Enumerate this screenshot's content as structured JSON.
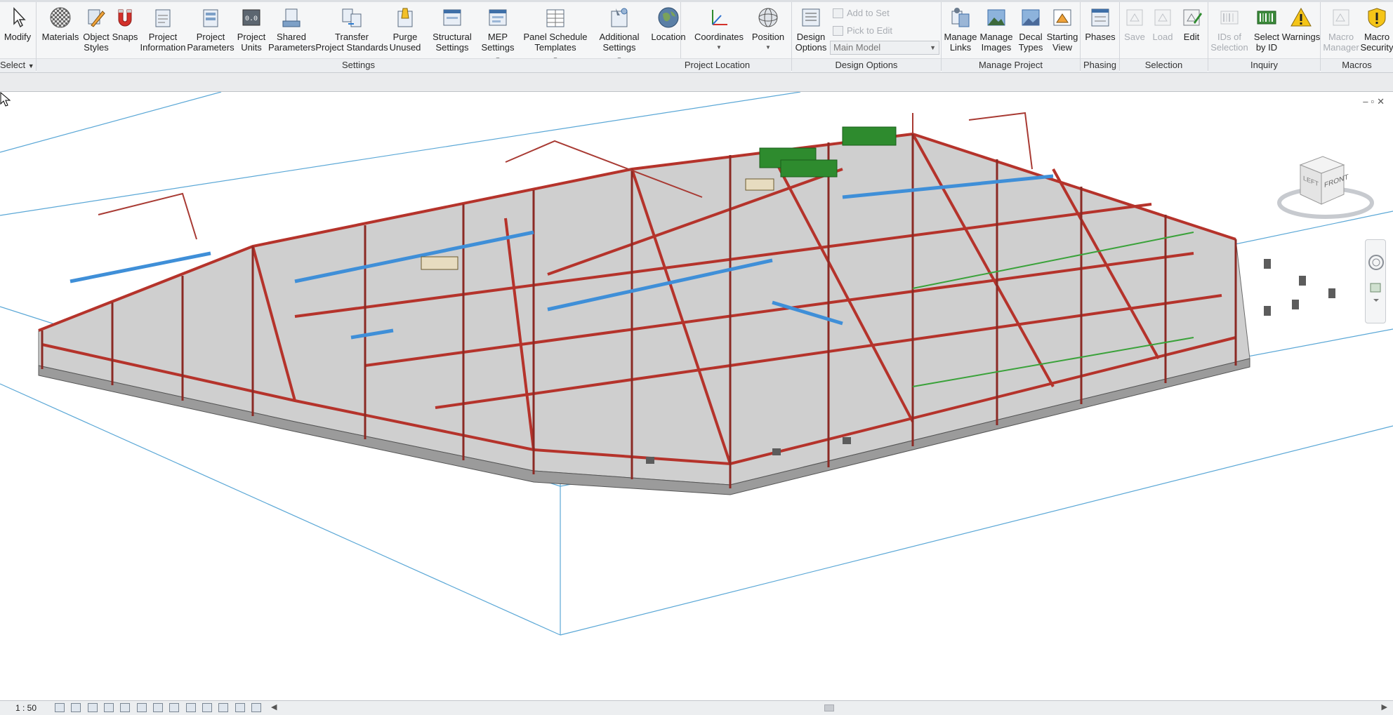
{
  "ribbon": {
    "select_label": "Select",
    "groups": {
      "settings": "Settings",
      "project_location": "Project Location",
      "design_options": "Design Options",
      "manage_project": "Manage Project",
      "phasing": "Phasing",
      "selection": "Selection",
      "inquiry": "Inquiry",
      "macros": "Macros"
    },
    "buttons": {
      "modify": "Modify",
      "materials": "Materials",
      "object_styles": "Object\nStyles",
      "snaps": "Snaps",
      "project_information": "Project\nInformation",
      "project_parameters": "Project\nParameters",
      "project_units": "Project\nUnits",
      "shared_parameters": "Shared\nParameters",
      "transfer_project_standards": "Transfer\nProject Standards",
      "purge_unused": "Purge\nUnused",
      "structural_settings": "Structural\nSettings",
      "mep_settings": "MEP\nSettings",
      "panel_schedule_templates": "Panel Schedule\nTemplates",
      "additional_settings": "Additional\nSettings",
      "location": "Location",
      "coordinates": "Coordinates",
      "position": "Position",
      "design_options_btn": "Design\nOptions",
      "add_to_set": "Add to Set",
      "pick_to_edit": "Pick to Edit",
      "main_model": "Main Model",
      "manage_links": "Manage\nLinks",
      "manage_images": "Manage\nImages",
      "decal_types": "Decal\nTypes",
      "starting_view": "Starting\nView",
      "phases": "Phases",
      "save": "Save",
      "load": "Load",
      "edit": "Edit",
      "ids_of_selection": "IDs of\nSelection",
      "select_by_id": "Select\nby ID",
      "warnings": "Warnings",
      "macro_manager": "Macro\nManager",
      "macro_security": "Macro\nSecurity"
    }
  },
  "viewcube": {
    "left": "LEFT",
    "front": "FRONT"
  },
  "status": {
    "scale": "1 : 50"
  },
  "colors": {
    "steel": "#b5332b",
    "floor": "#c9c9c9",
    "duct": "#3f8fd8",
    "equipment": "#2e8b2e",
    "section_box": "#5aa7d6"
  }
}
